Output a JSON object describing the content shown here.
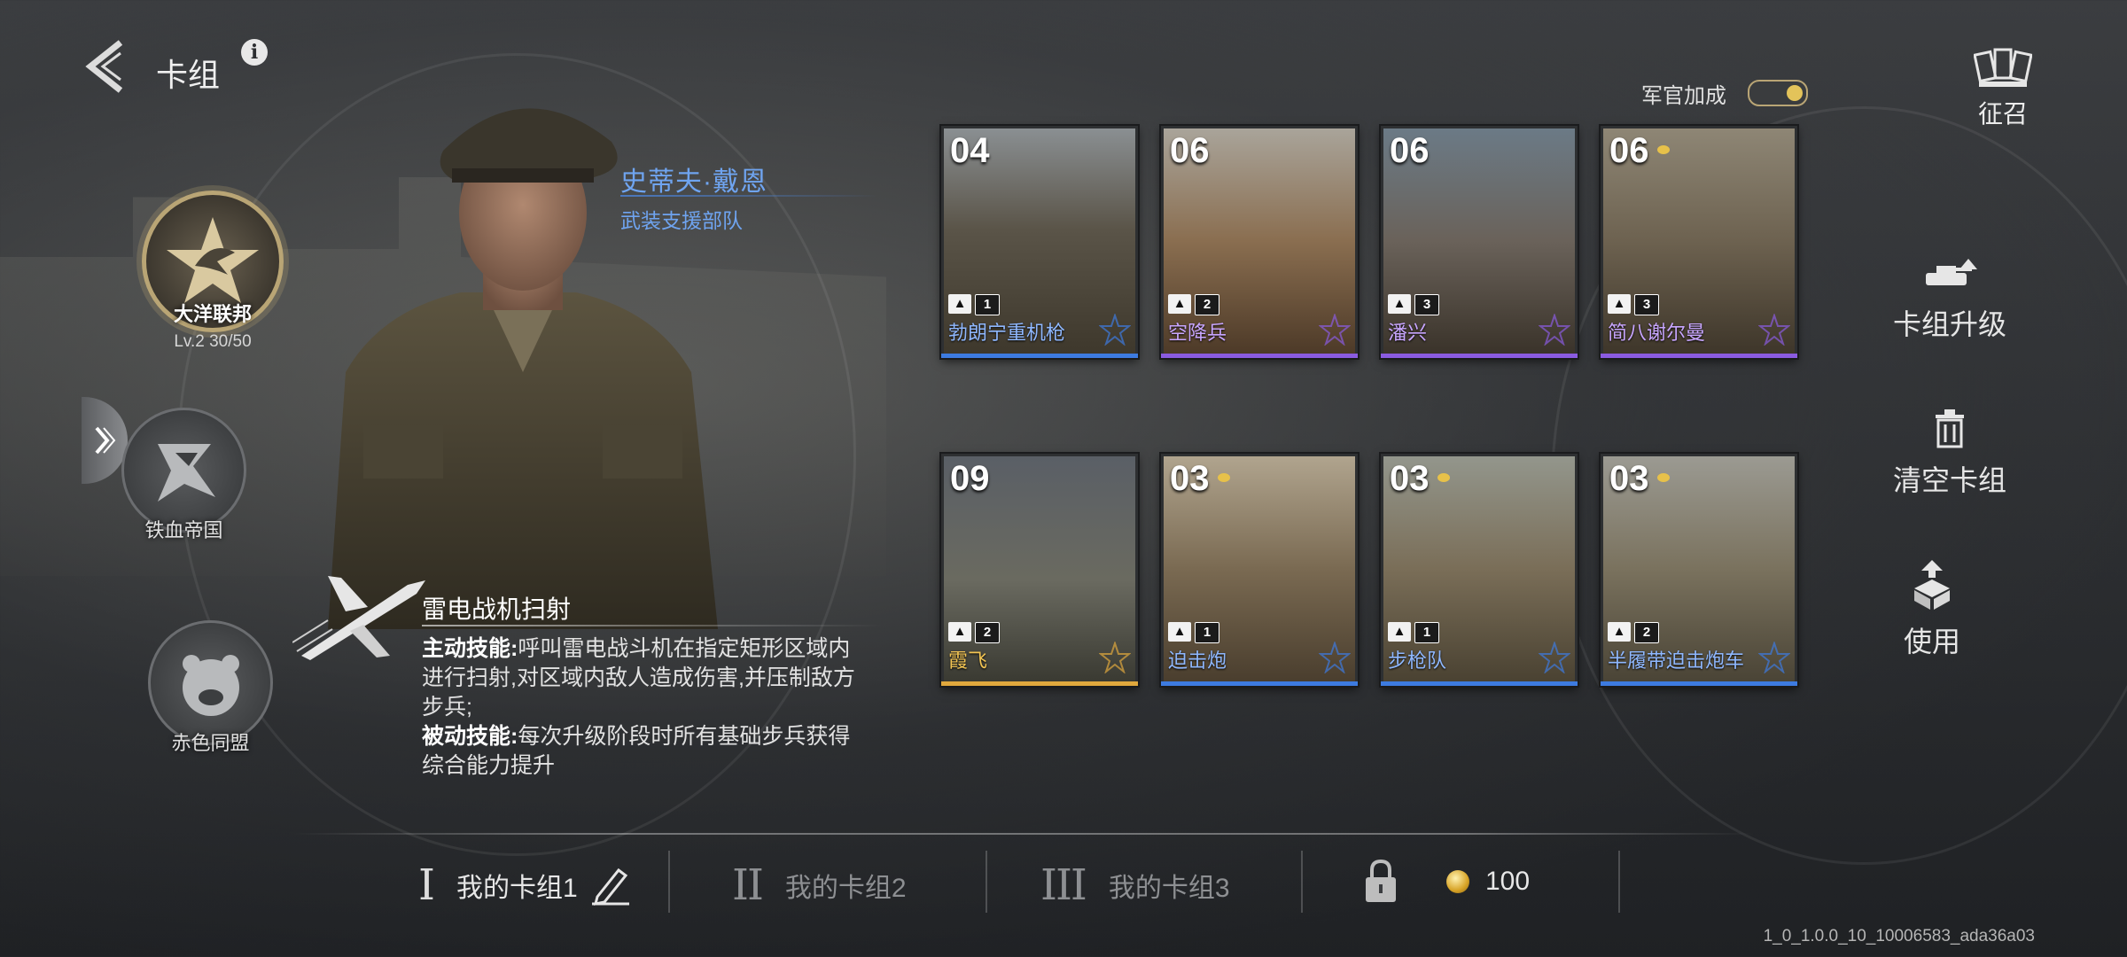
{
  "header": {
    "title": "卡组"
  },
  "factions": [
    {
      "name": "大洋联邦",
      "level": "Lv.2  30/50"
    },
    {
      "name": "铁血帝国"
    },
    {
      "name": "赤色同盟"
    }
  ],
  "commander": {
    "name": "史蒂夫·戴恩",
    "unit": "武装支援部队"
  },
  "skill": {
    "title": "雷电战机扫射",
    "active_label": "主动技能:",
    "active_text": "呼叫雷电战斗机在指定矩形区域内进行扫射,对区域内敌人造成伤害,并压制敌方步兵;",
    "passive_label": "被动技能:",
    "passive_text": "每次升级阶段时所有基础步兵获得综合能力提升"
  },
  "officer_bonus": {
    "label": "军官加成",
    "enabled": true
  },
  "recruit": {
    "label": "征召"
  },
  "actions": {
    "upgrade": "卡组升级",
    "clear": "清空卡组",
    "use": "使用"
  },
  "cards": [
    {
      "cost": "04",
      "name": "勃朗宁重机枪",
      "level": "1",
      "rarity": "blue"
    },
    {
      "cost": "06",
      "name": "空降兵",
      "level": "2",
      "rarity": "purple"
    },
    {
      "cost": "06",
      "name": "潘兴",
      "level": "3",
      "rarity": "purple"
    },
    {
      "cost": "06",
      "name": "简八谢尔曼",
      "level": "3",
      "rarity": "purple"
    },
    {
      "cost": "09",
      "name": "霞飞",
      "level": "2",
      "rarity": "gold"
    },
    {
      "cost": "03",
      "name": "迫击炮",
      "level": "1",
      "rarity": "blue"
    },
    {
      "cost": "03",
      "name": "步枪队",
      "level": "1",
      "rarity": "blue"
    },
    {
      "cost": "03",
      "name": "半履带迫击炮车",
      "level": "2",
      "rarity": "blue"
    }
  ],
  "decks": [
    {
      "roman": "I",
      "label": "我的卡组1",
      "active": true
    },
    {
      "roman": "II",
      "label": "我的卡组2",
      "active": false
    },
    {
      "roman": "III",
      "label": "我的卡组3",
      "active": false
    }
  ],
  "currency": {
    "amount": "100"
  },
  "version": "1_0_1.0.0_10_10006583_ada36a03",
  "colors": {
    "blue": "#3d7be0",
    "purple": "#8a5be0",
    "gold": "#e0a83d",
    "name_blue": "#6fa4f0"
  }
}
